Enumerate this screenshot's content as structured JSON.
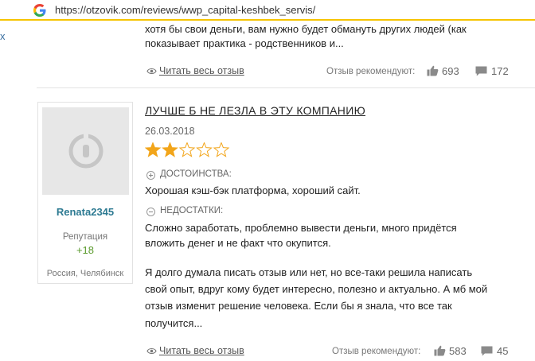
{
  "browser": {
    "url": "https://otzovik.com/reviews/wwp_capital-keshbek_servis/"
  },
  "left_edge_mark": "x",
  "review_prev": {
    "lines": [
      "хотя бы свои деньги, вам нужно будет обмануть других людей (как",
      "показывает практика - родственников и..."
    ],
    "read_more": "Читать весь отзыв",
    "recommend_label": "Отзыв рекомендуют:",
    "likes": "693",
    "comments": "172"
  },
  "review": {
    "author": {
      "name": "Renata2345",
      "reputation_label": "Репутация",
      "reputation_value": "+18",
      "location": "Россия, Челябинск"
    },
    "title": "ЛУЧШЕ Б НЕ ЛЕЗЛА В ЭТУ КОМПАНИЮ",
    "date": "26.03.2018",
    "rating": 2,
    "rating_max": 5,
    "pros_label": "ДОСТОИНСТВА:",
    "pros_text": "Хорошая кэш-бэк платформа, хороший сайт.",
    "cons_label": "НЕДОСТАТКИ:",
    "cons_lines": [
      "Сложно заработать, проблемно вывести деньги, много придётся",
      "вложить денег и не факт что окупится."
    ],
    "body_lines": [
      "Я долго думала писать отзыв или нет, но все-таки решила написать",
      "свой опыт, вдруг кому будет интересно, полезно и актуально. А мб мой",
      "отзыв изменит решение человека. Если бы я знала, что все так",
      "получится..."
    ],
    "read_more": "Читать весь отзыв",
    "recommend_label": "Отзыв рекомендуют:",
    "likes": "583",
    "comments": "45"
  },
  "colors": {
    "star": "#f2a51a",
    "username": "#2d7a92",
    "reputation": "#5a9a2c",
    "url_bar_border": "#f6c400"
  }
}
